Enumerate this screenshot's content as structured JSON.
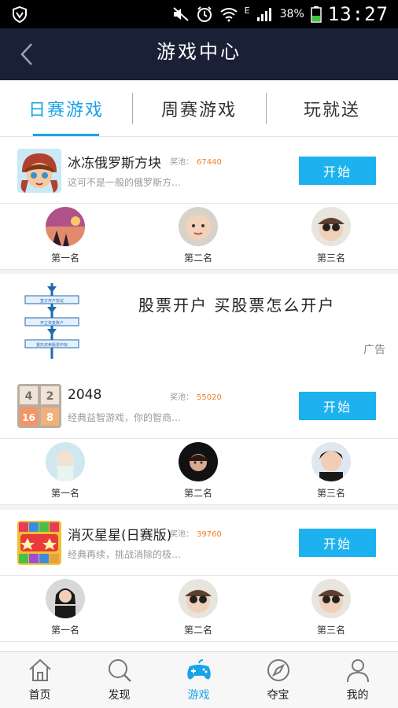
{
  "status_bar": {
    "battery": "38%",
    "time": "13:27",
    "network": "E"
  },
  "title_bar": {
    "title": "游戏中心"
  },
  "tabs": [
    {
      "label": "日赛游戏",
      "active": true
    },
    {
      "label": "周赛游戏",
      "active": false
    },
    {
      "label": "玩就送",
      "active": false
    }
  ],
  "games": [
    {
      "name": "冰冻俄罗斯方块",
      "prize_label": "奖池：",
      "prize": "67440",
      "desc": "这可不是一般的俄罗斯方…",
      "start_label": "开始",
      "ranks": [
        "第一名",
        "第二名",
        "第三名"
      ]
    },
    {
      "name": "2048",
      "prize_label": "奖池：",
      "prize": "55020",
      "desc": "经典益智游戏，你的智商…",
      "start_label": "开始",
      "ranks": [
        "第一名",
        "第二名",
        "第三名"
      ],
      "tiles": [
        "4",
        "2",
        "16",
        "8"
      ]
    },
    {
      "name": "消灭星星(日赛版)",
      "prize_label": "奖池：",
      "prize": "39760",
      "desc": "经典再续，挑战消除的极…",
      "start_label": "开始",
      "ranks": [
        "第一名",
        "第二名",
        "第三名"
      ]
    }
  ],
  "ad": {
    "title": "股票开户 买股票怎么开户",
    "tag": "广告",
    "flow_steps": [
      "签订开户协议",
      "开立资金账户",
      "委托买卖股票中标"
    ]
  },
  "bottom_nav": [
    {
      "label": "首页",
      "icon": "home-icon"
    },
    {
      "label": "发现",
      "icon": "search-icon"
    },
    {
      "label": "游戏",
      "icon": "gamepad-icon",
      "active": true
    },
    {
      "label": "夺宝",
      "icon": "compass-icon"
    },
    {
      "label": "我的",
      "icon": "user-icon"
    }
  ],
  "colors": {
    "accent": "#1aa3e8",
    "button": "#1db2ef",
    "prize": "#f07d2e",
    "header": "#1a2036"
  }
}
